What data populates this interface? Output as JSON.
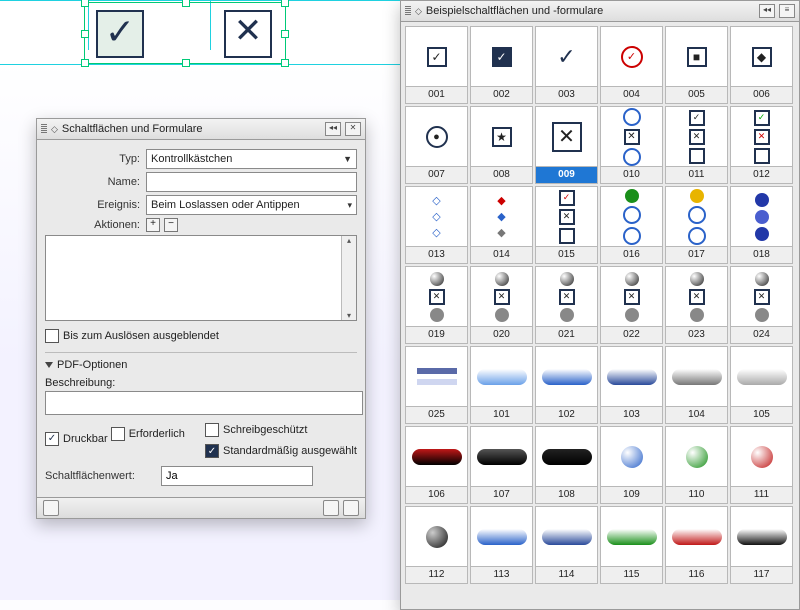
{
  "canvas": {
    "checkbox_checked_glyph": "✓",
    "checkbox_cross_glyph": "✕"
  },
  "props_panel": {
    "title": "Schaltflächen und Formulare",
    "labels": {
      "typ": "Typ:",
      "name": "Name:",
      "ereignis": "Ereignis:",
      "aktionen": "Aktionen:",
      "hide_until": "Bis zum Auslösen ausgeblendet",
      "pdf_section": "PDF-Optionen",
      "beschreibung": "Beschreibung:",
      "druckbar": "Druckbar",
      "schreibgeschuetzt": "Schreibgeschützt",
      "erforderlich": "Erforderlich",
      "standard": "Standardmäßig ausgewählt",
      "schaltflaechenwert": "Schaltflächenwert:"
    },
    "values": {
      "typ": "Kontrollkästchen",
      "name": "",
      "ereignis": "Beim Loslassen oder Antippen",
      "beschreibung": "",
      "schaltflaechenwert": "Ja",
      "druckbar_checked": true,
      "schreibgeschuetzt_checked": false,
      "erforderlich_checked": false,
      "standard_checked": true,
      "hide_until_checked": false
    }
  },
  "samples_panel": {
    "title": "Beispielschaltflächen und -formulare",
    "selected_id": "009",
    "items": [
      {
        "id": "001"
      },
      {
        "id": "002"
      },
      {
        "id": "003"
      },
      {
        "id": "004"
      },
      {
        "id": "005"
      },
      {
        "id": "006"
      },
      {
        "id": "007"
      },
      {
        "id": "008"
      },
      {
        "id": "009"
      },
      {
        "id": "010"
      },
      {
        "id": "011"
      },
      {
        "id": "012"
      },
      {
        "id": "013"
      },
      {
        "id": "014"
      },
      {
        "id": "015"
      },
      {
        "id": "016"
      },
      {
        "id": "017"
      },
      {
        "id": "018"
      },
      {
        "id": "019"
      },
      {
        "id": "020"
      },
      {
        "id": "021"
      },
      {
        "id": "022"
      },
      {
        "id": "023"
      },
      {
        "id": "024"
      },
      {
        "id": "025"
      },
      {
        "id": "101"
      },
      {
        "id": "102"
      },
      {
        "id": "103"
      },
      {
        "id": "104"
      },
      {
        "id": "105"
      },
      {
        "id": "106"
      },
      {
        "id": "107"
      },
      {
        "id": "108"
      },
      {
        "id": "109"
      },
      {
        "id": "110"
      },
      {
        "id": "111"
      },
      {
        "id": "112"
      },
      {
        "id": "113"
      },
      {
        "id": "114"
      },
      {
        "id": "115"
      },
      {
        "id": "116"
      },
      {
        "id": "117"
      }
    ]
  }
}
